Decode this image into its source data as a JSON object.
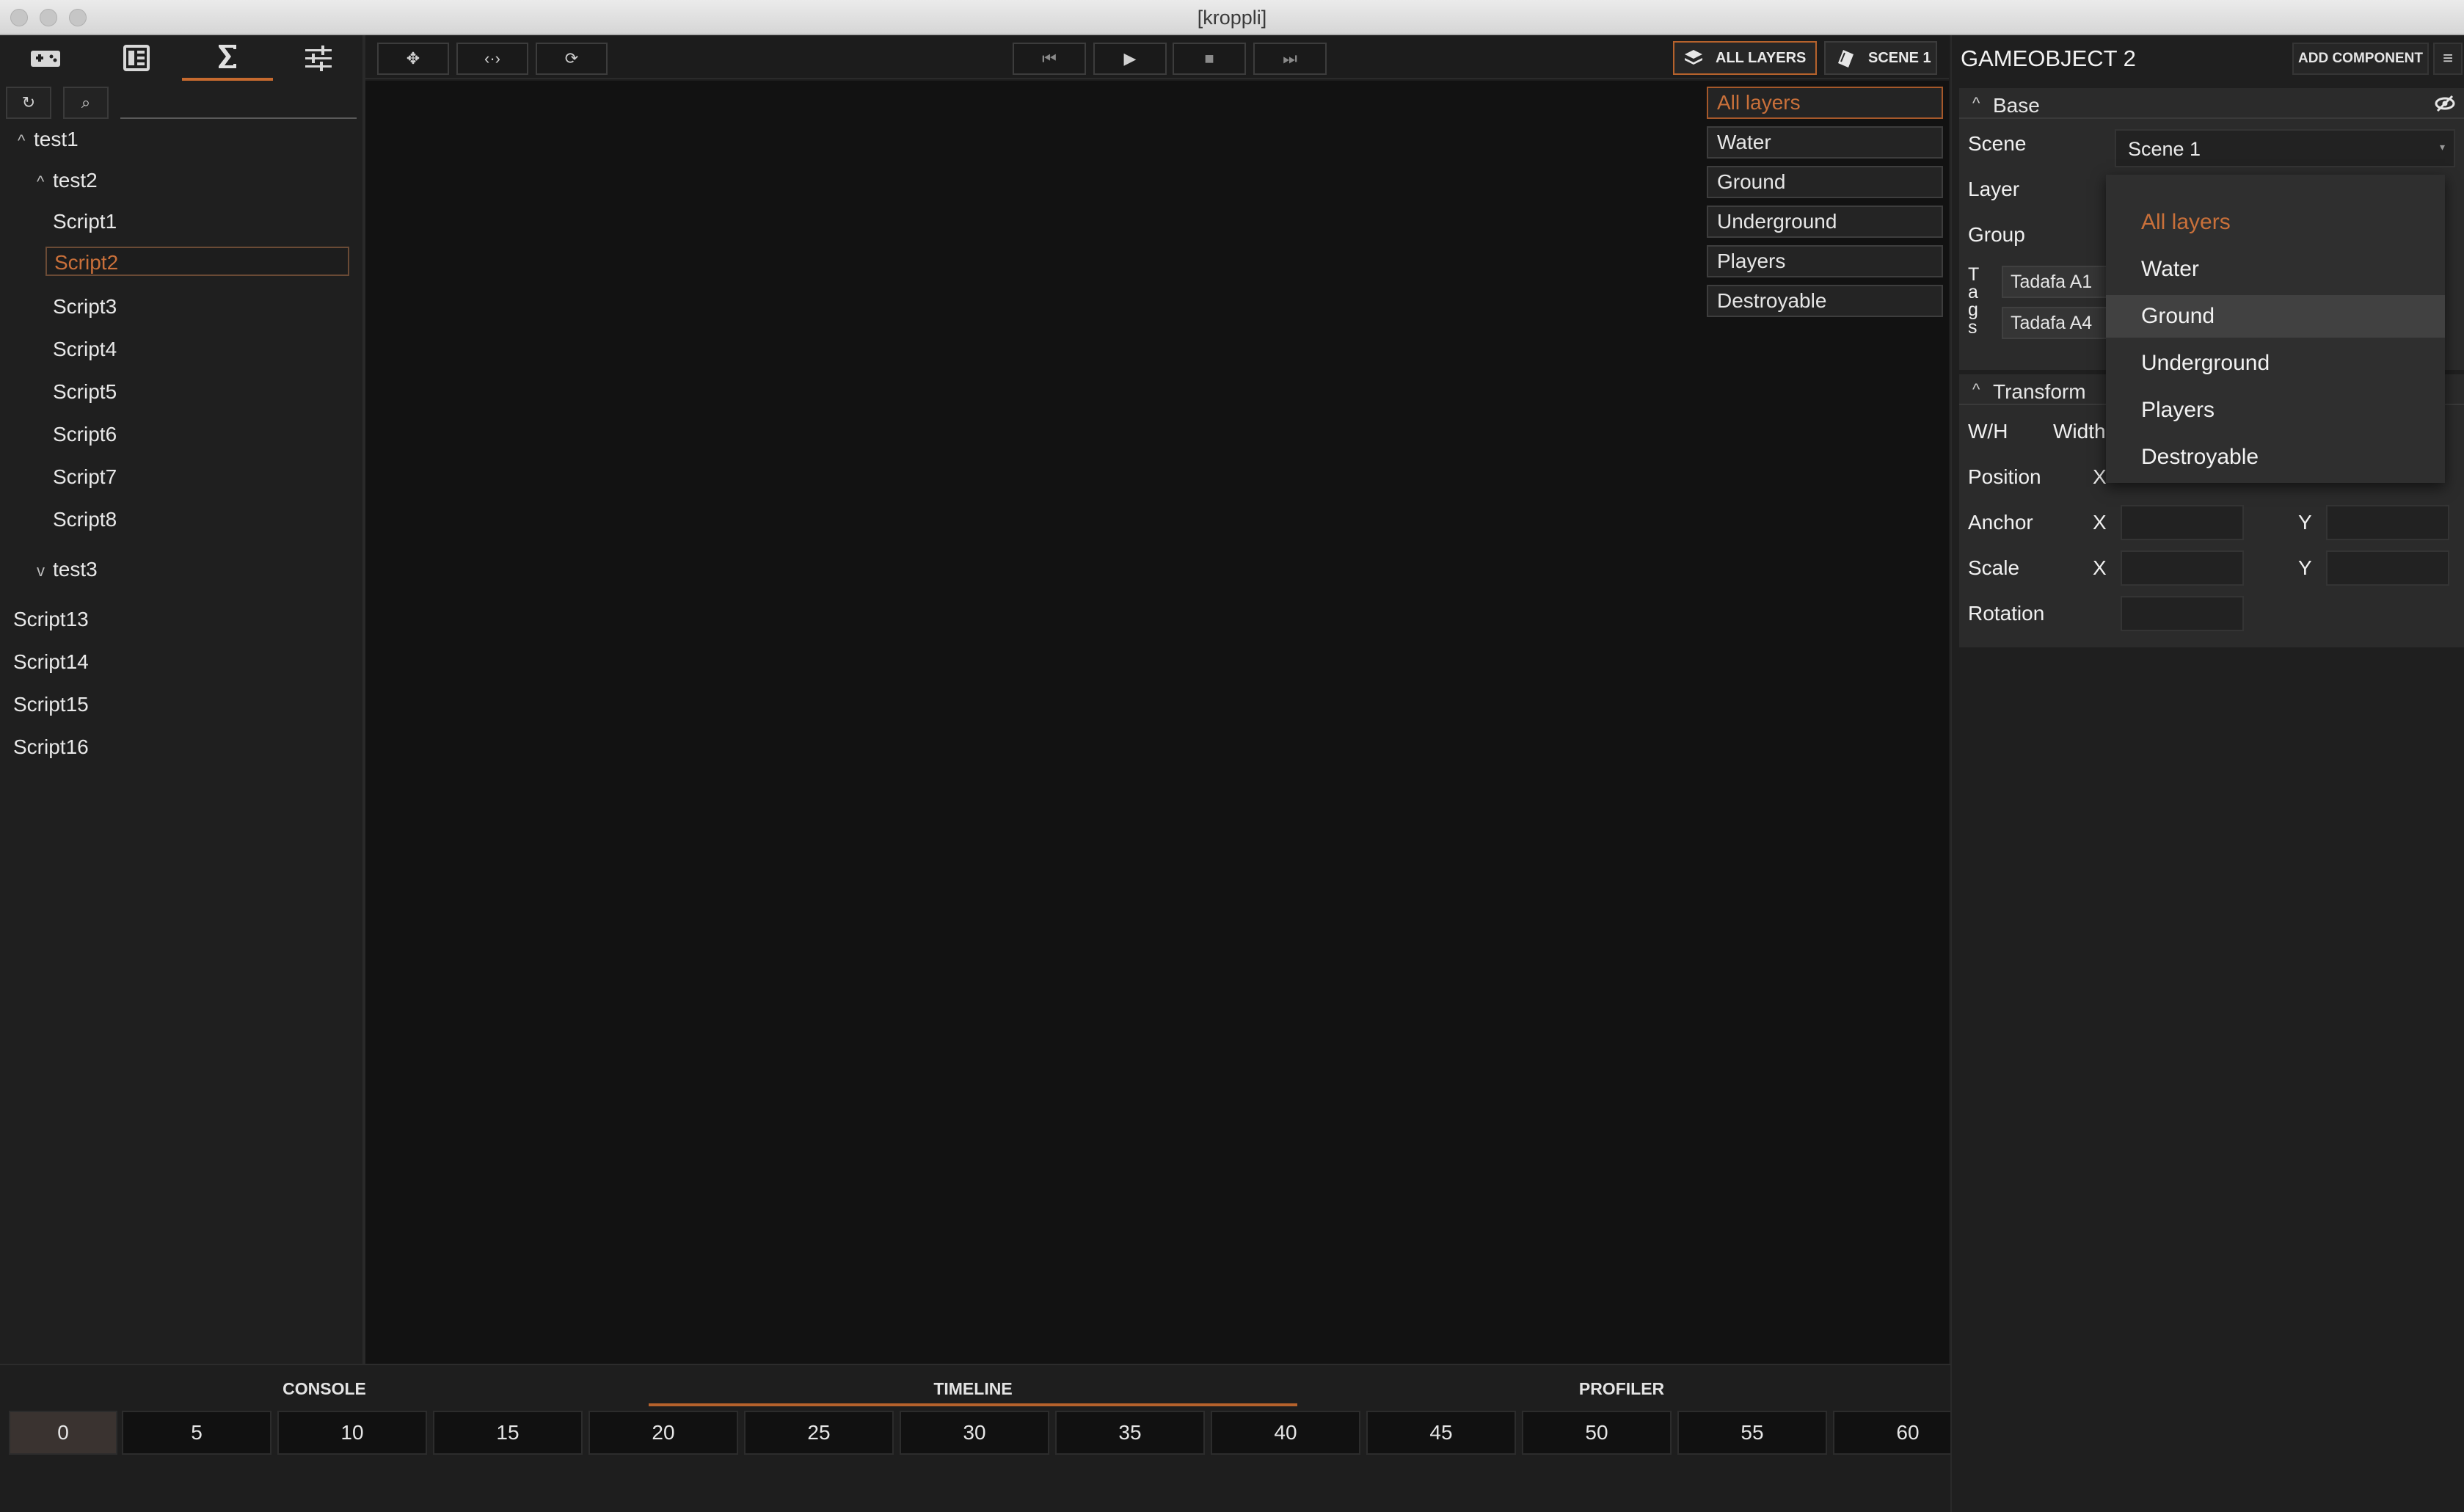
{
  "window": {
    "title": "[kroppli]"
  },
  "left_panel": {
    "tabs": [
      {
        "icon": "gamepad-icon"
      },
      {
        "icon": "panel-icon"
      },
      {
        "icon": "sigma-icon"
      },
      {
        "icon": "sliders-icon"
      }
    ],
    "active_tab": 2,
    "refresh_icon": "↻",
    "search_icon": "⌕",
    "search_placeholder": "",
    "tree": [
      {
        "label": "test1",
        "caret": "^",
        "depth": 1
      },
      {
        "label": "test2",
        "caret": "^",
        "depth": 2
      },
      {
        "label": "Script1",
        "depth": 3
      },
      {
        "label": "Script2",
        "depth": 3,
        "selected": true
      },
      {
        "label": "Script3",
        "depth": 3
      },
      {
        "label": "Script4",
        "depth": 3
      },
      {
        "label": "Script5",
        "depth": 3
      },
      {
        "label": "Script6",
        "depth": 3
      },
      {
        "label": "Script7",
        "depth": 3
      },
      {
        "label": "Script8",
        "depth": 3
      },
      {
        "label": "test3",
        "caret": "v",
        "depth": 2
      },
      {
        "label": "Script13",
        "depth": 0
      },
      {
        "label": "Script14",
        "depth": 0
      },
      {
        "label": "Script15",
        "depth": 0
      },
      {
        "label": "Script16",
        "depth": 0
      }
    ]
  },
  "toolbar": {
    "move_icon": "✥",
    "resize_icon": "‹·›",
    "rotate_icon": "⟳",
    "first_icon": "⏮",
    "play_icon": "▶",
    "stop_icon": "■",
    "last_icon": "⏭",
    "all_layers_label": "ALL LAYERS",
    "scene_label": "SCENE 1"
  },
  "viewport": {
    "layers": [
      "All layers",
      "Water",
      "Ground",
      "Underground",
      "Players",
      "Destroyable"
    ],
    "active_layer": 0
  },
  "bottom": {
    "tabs": [
      "CONSOLE",
      "TIMELINE",
      "PROFILER"
    ],
    "active_tab": 1,
    "timeline_ticks": [
      "0",
      "5",
      "10",
      "15",
      "20",
      "25",
      "30",
      "35",
      "40",
      "45",
      "50",
      "55",
      "60"
    ],
    "active_tick": 0
  },
  "inspector": {
    "title": "GAMEOBJECT 2",
    "add_component_label": "ADD COMPONENT",
    "menu_icon": "≡",
    "base": {
      "header": "Base",
      "caret": "^",
      "eye_icon": "eye-off-icon",
      "scene_label": "Scene",
      "scene_value": "Scene 1",
      "layer_label": "Layer",
      "group_label": "Group",
      "tags_label": [
        "T",
        "a",
        "g",
        "s"
      ],
      "tags": [
        "Tadafa A1",
        "Tadafa A4"
      ]
    },
    "transform": {
      "header": "Transform",
      "caret": "^",
      "wh_label": "W/H",
      "width_label": "Width",
      "position_label": "Position",
      "anchor_label": "Anchor",
      "scale_label": "Scale",
      "rotation_label": "Rotation",
      "x_label": "X",
      "y_label": "Y"
    },
    "layer_dropdown": {
      "options": [
        "All layers",
        "Water",
        "Ground",
        "Underground",
        "Players",
        "Destroyable"
      ],
      "active_index": 0,
      "hover_index": 2
    }
  },
  "colors": {
    "accent": "#c9703a",
    "viewport_bg": "#121212",
    "panel_bg": "#1f1f1f"
  }
}
